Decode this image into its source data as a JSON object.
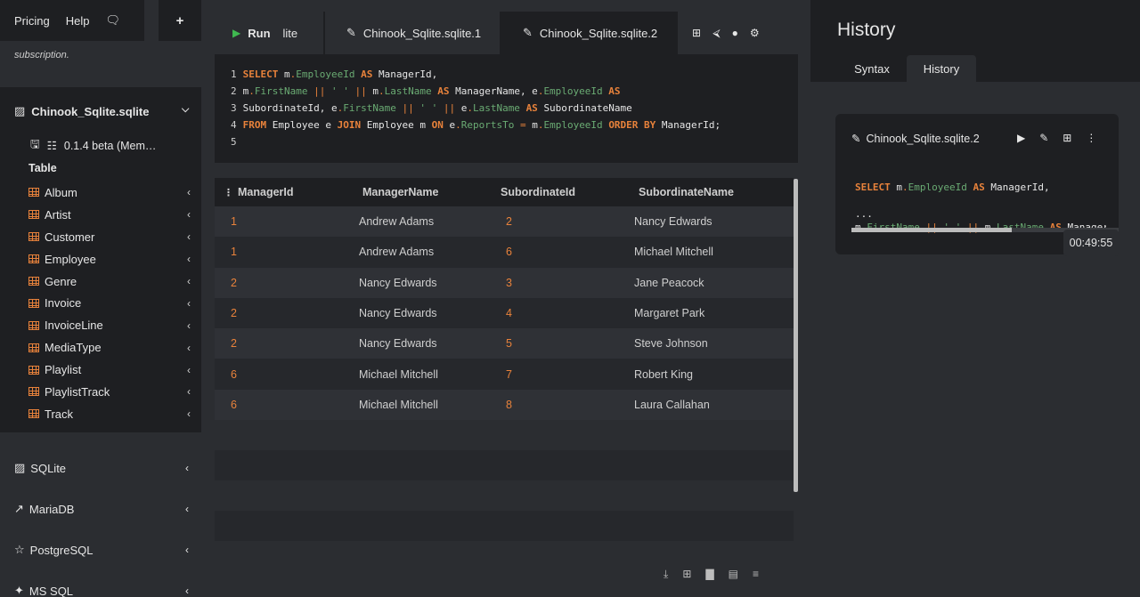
{
  "topbar": {
    "pricing": "Pricing",
    "help": "Help",
    "chat_icon": "chat-icon",
    "add_icon": "plus-icon"
  },
  "subnote": "subscription.",
  "database": {
    "name": "Chinook_Sqlite.sqlite",
    "meta": "0.1.4 beta (Mem…",
    "table_label": "Table",
    "tables": [
      "Album",
      "Artist",
      "Customer",
      "Employee",
      "Genre",
      "Invoice",
      "InvoiceLine",
      "MediaType",
      "Playlist",
      "PlaylistTrack",
      "Track"
    ]
  },
  "engines": [
    "SQLite",
    "MariaDB",
    "PostgreSQL",
    "MS SQL"
  ],
  "tabs": {
    "run_label": "Run",
    "run_fragment": "lite",
    "tab1": "Chinook_Sqlite.sqlite.1",
    "tab2": "Chinook_Sqlite.sqlite.2"
  },
  "editor": {
    "line_numbers": [
      "1",
      "2",
      "3",
      "4",
      "5"
    ]
  },
  "grid": {
    "columns": [
      "ManagerId",
      "ManagerName",
      "SubordinateId",
      "SubordinateName"
    ],
    "rows": [
      [
        "1",
        "Andrew Adams",
        "2",
        "Nancy Edwards"
      ],
      [
        "1",
        "Andrew Adams",
        "6",
        "Michael Mitchell"
      ],
      [
        "2",
        "Nancy Edwards",
        "3",
        "Jane Peacock"
      ],
      [
        "2",
        "Nancy Edwards",
        "4",
        "Margaret Park"
      ],
      [
        "2",
        "Nancy Edwards",
        "5",
        "Steve Johnson"
      ],
      [
        "6",
        "Michael Mitchell",
        "7",
        "Robert King"
      ],
      [
        "6",
        "Michael Mitchell",
        "8",
        "Laura Callahan"
      ]
    ]
  },
  "history": {
    "title": "History",
    "tab_syntax": "Syntax",
    "tab_history": "History",
    "card_title": "Chinook_Sqlite.sqlite.2",
    "ellipsis": "...",
    "progress": 0.6,
    "timer": "00:49:55"
  },
  "colors": {
    "accent": "#e8823b",
    "field": "#6aab73",
    "run": "#3fb950",
    "panel": "#1e1f22",
    "bg": "#2b2d31"
  }
}
